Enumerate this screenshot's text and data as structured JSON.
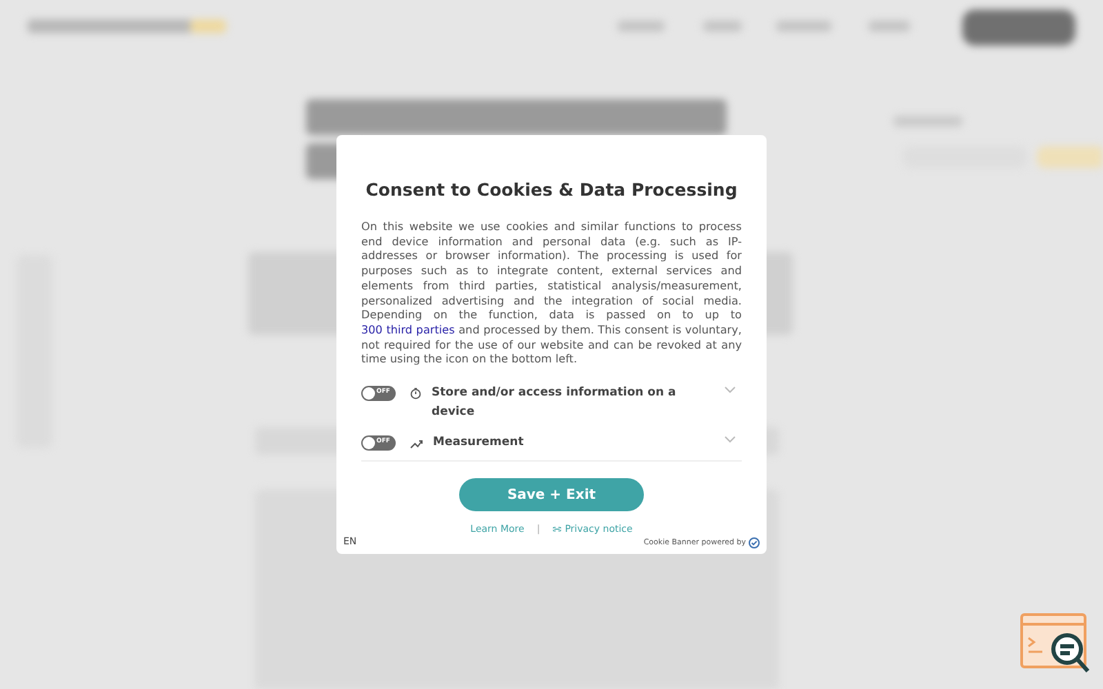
{
  "dialog": {
    "title": "Consent to Cookies & Data Processing",
    "body_before_link": "On this website we use cookies and similar functions to process end device information and personal data (e.g. such as IP-addresses or browser information). The processing is used for purposes such as to integrate content, external services and elements from third parties, statistical analysis/measurement, personalized advertising and the integration of social media. Depending on the function, data is passed on to up to ",
    "link": "300 third parties",
    "body_after_link": " and processed by them. This consent is voluntary, not required for the use of our website and can be revoked at any time using the icon on the bottom left.",
    "purposes": [
      {
        "kind": "storage",
        "label": "Store and/or access information on a device",
        "switch_text": "OFF",
        "on": false,
        "expanded": false
      },
      {
        "kind": "measurement",
        "label": "Measurement",
        "switch_text": "OFF",
        "on": false,
        "expanded": false
      }
    ],
    "save_button": "Save + Exit",
    "learn_more": "Learn More",
    "separator": "|",
    "privacy_notice": "Privacy notice",
    "language": "EN",
    "powered_by": "Cookie Banner powered by"
  }
}
